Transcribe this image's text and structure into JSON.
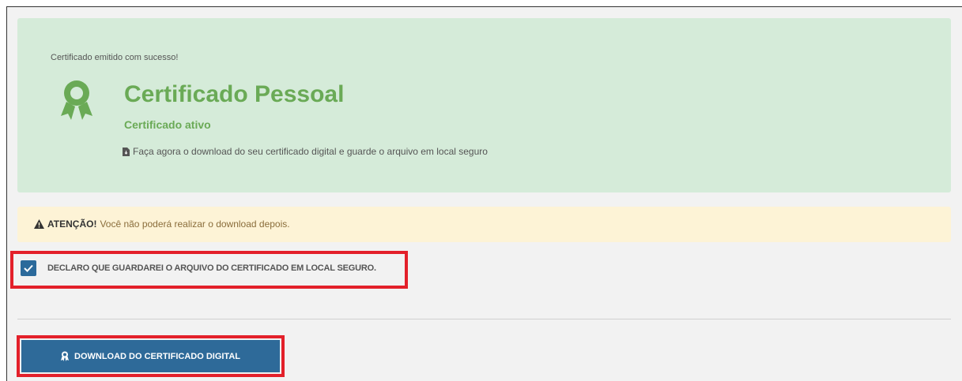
{
  "success": {
    "message": "Certificado emitido com sucesso!",
    "title": "Certificado Pessoal",
    "subtitle": "Certificado ativo",
    "note": "Faça agora o download do seu certificado digital e guarde o arquivo em local seguro",
    "award_icon": "award-icon",
    "note_icon": "file-download-icon"
  },
  "warning": {
    "strong": "ATENÇÃO!",
    "text": "Você não poderá realizar o download depois.",
    "icon": "warning-icon"
  },
  "declaration": {
    "label": "DECLARO QUE GUARDAREI O ARQUIVO DO CERTIFICADO EM LOCAL SEGURO.",
    "checked": true
  },
  "download": {
    "label": "DOWNLOAD DO CERTIFICADO DIGITAL",
    "icon": "award-icon"
  },
  "colors": {
    "success_bg": "#d5ebd9",
    "success_text": "#6aaa56",
    "warning_bg": "#fdf3d6",
    "primary": "#2e6a99",
    "highlight": "#e3202a"
  }
}
